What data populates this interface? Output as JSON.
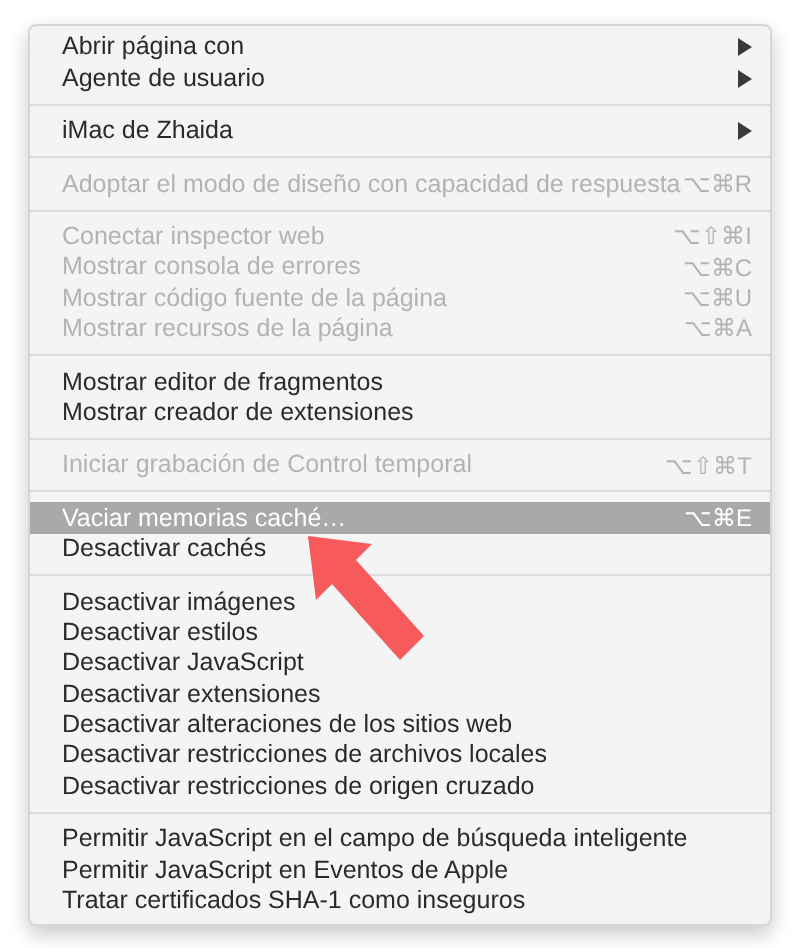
{
  "menu": {
    "groups": [
      {
        "items": [
          {
            "label": "Abrir página con",
            "submenu": true,
            "disabled": false,
            "selected": false
          },
          {
            "label": "Agente de usuario",
            "submenu": true,
            "disabled": false,
            "selected": false
          }
        ]
      },
      {
        "items": [
          {
            "label": "iMac de Zhaida",
            "submenu": true,
            "disabled": false,
            "selected": false
          }
        ]
      },
      {
        "items": [
          {
            "label": "Adoptar el modo de diseño con capacidad de respuesta",
            "shortcut": "⌥⌘R",
            "submenu": false,
            "disabled": true,
            "selected": false
          }
        ]
      },
      {
        "items": [
          {
            "label": "Conectar inspector web",
            "shortcut": "⌥⇧⌘I",
            "submenu": false,
            "disabled": true,
            "selected": false
          },
          {
            "label": "Mostrar consola de errores",
            "shortcut": "⌥⌘C",
            "submenu": false,
            "disabled": true,
            "selected": false
          },
          {
            "label": "Mostrar código fuente de la página",
            "shortcut": "⌥⌘U",
            "submenu": false,
            "disabled": true,
            "selected": false
          },
          {
            "label": "Mostrar recursos de la página",
            "shortcut": "⌥⌘A",
            "submenu": false,
            "disabled": true,
            "selected": false
          }
        ]
      },
      {
        "items": [
          {
            "label": "Mostrar editor de fragmentos",
            "submenu": false,
            "disabled": false,
            "selected": false
          },
          {
            "label": "Mostrar creador de extensiones",
            "submenu": false,
            "disabled": false,
            "selected": false
          }
        ]
      },
      {
        "items": [
          {
            "label": "Iniciar grabación de Control temporal",
            "shortcut": "⌥⇧⌘T",
            "submenu": false,
            "disabled": true,
            "selected": false
          }
        ]
      },
      {
        "items": [
          {
            "label": "Vaciar memorias caché…",
            "shortcut": "⌥⌘E",
            "submenu": false,
            "disabled": false,
            "selected": true
          },
          {
            "label": "Desactivar cachés",
            "submenu": false,
            "disabled": false,
            "selected": false
          }
        ]
      },
      {
        "items": [
          {
            "label": "Desactivar imágenes",
            "submenu": false,
            "disabled": false,
            "selected": false
          },
          {
            "label": "Desactivar estilos",
            "submenu": false,
            "disabled": false,
            "selected": false
          },
          {
            "label": "Desactivar JavaScript",
            "submenu": false,
            "disabled": false,
            "selected": false
          },
          {
            "label": "Desactivar extensiones",
            "submenu": false,
            "disabled": false,
            "selected": false
          },
          {
            "label": "Desactivar alteraciones de los sitios web",
            "submenu": false,
            "disabled": false,
            "selected": false
          },
          {
            "label": "Desactivar restricciones de archivos locales",
            "submenu": false,
            "disabled": false,
            "selected": false
          },
          {
            "label": "Desactivar restricciones de origen cruzado",
            "submenu": false,
            "disabled": false,
            "selected": false
          }
        ]
      },
      {
        "items": [
          {
            "label": "Permitir JavaScript en el campo de búsqueda inteligente",
            "submenu": false,
            "disabled": false,
            "selected": false
          },
          {
            "label": "Permitir JavaScript en Eventos de Apple",
            "submenu": false,
            "disabled": false,
            "selected": false
          },
          {
            "label": "Tratar certificados SHA-1 como inseguros",
            "submenu": false,
            "disabled": false,
            "selected": false
          }
        ]
      }
    ]
  }
}
